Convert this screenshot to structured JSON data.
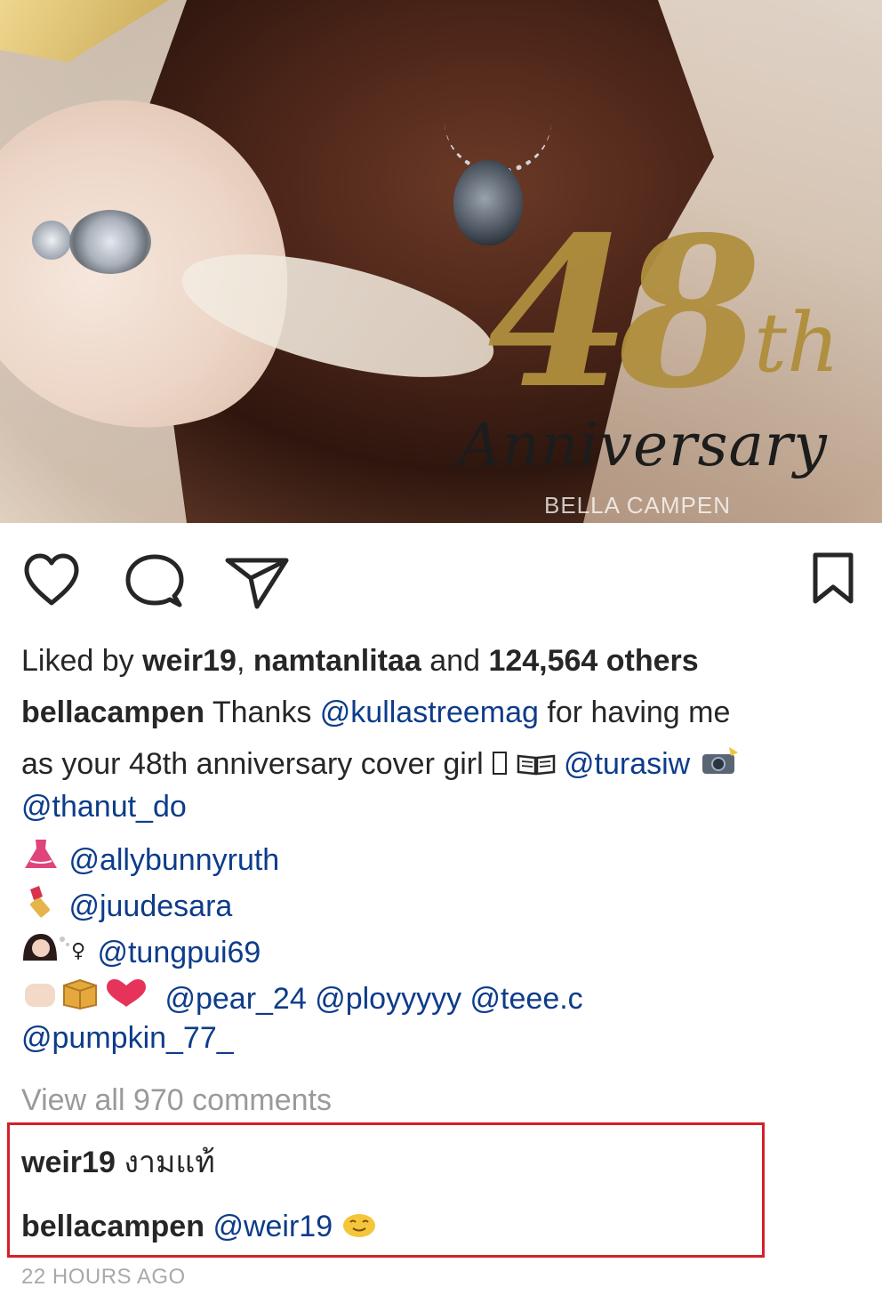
{
  "post": {
    "image": {
      "numeral": "48",
      "suffix": "th",
      "title": "Anniversary",
      "brand": "BELLA CAMPEN"
    },
    "actions": {
      "like_icon": "heart-outline-icon",
      "comment_icon": "speech-bubble-icon",
      "share_icon": "paper-plane-icon",
      "save_icon": "bookmark-icon"
    },
    "likes": {
      "prefix": "Liked by ",
      "user1": "weir19",
      "separator": ", ",
      "user2": "namtanlitaa",
      "conjunction": " and ",
      "count": "124,564 others"
    },
    "caption": {
      "author": "bellacampen",
      "text_a": " Thanks ",
      "mention_mag": "@kullastreemag",
      "text_b": " for having me",
      "text_c": "as your 48th anniversary cover girl ",
      "mention_turasiw": "@turasiw",
      "mention_thanut": "@thanut_do",
      "mention_ally": "@allybunnyruth",
      "mention_juude": "@juudesara",
      "mention_tungpui": "@tungpui69",
      "mention_pear": "@pear_24",
      "mention_ploy": "@ployyyyy",
      "mention_teee": "@teee.c",
      "mention_pumpkin": "@pumpkin_77_"
    },
    "view_all_comments": "View all 970 comments",
    "comments": [
      {
        "author": "weir19",
        "text": "งามแท้"
      },
      {
        "author": "bellacampen",
        "mention": "@weir19"
      }
    ],
    "timestamp": "22 HOURS AGO"
  }
}
